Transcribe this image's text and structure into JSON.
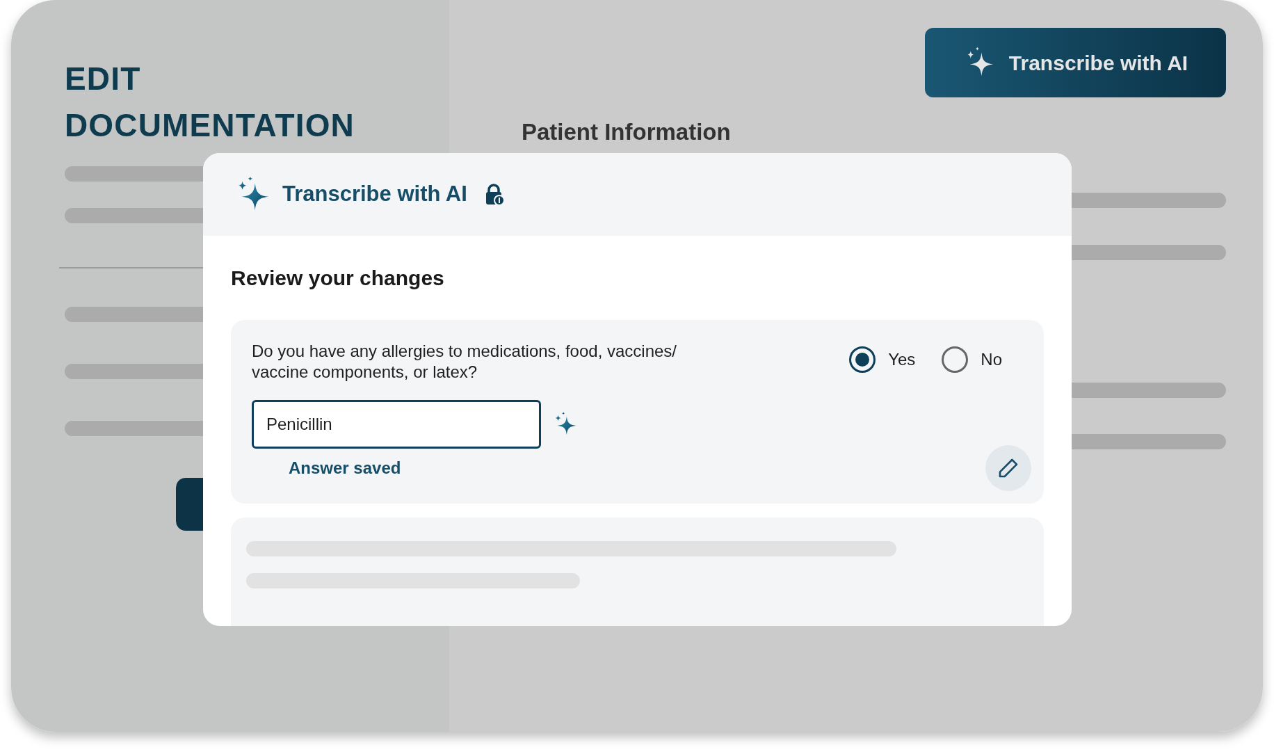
{
  "page": {
    "title_lines": [
      "EDIT",
      "DOCUMENTATION"
    ],
    "action_button": "Transcribe with AI",
    "section_heading": "Patient Information"
  },
  "modal": {
    "title": "Transcribe with AI",
    "heading": "Review your changes",
    "question": {
      "text": "Do you have any allergies to medications, food, vaccines/ vaccine components, or latex?",
      "options": [
        {
          "label": "Yes",
          "selected": true
        },
        {
          "label": "No",
          "selected": false
        }
      ],
      "answer": "Penicillin",
      "status": "Answer saved"
    }
  }
}
